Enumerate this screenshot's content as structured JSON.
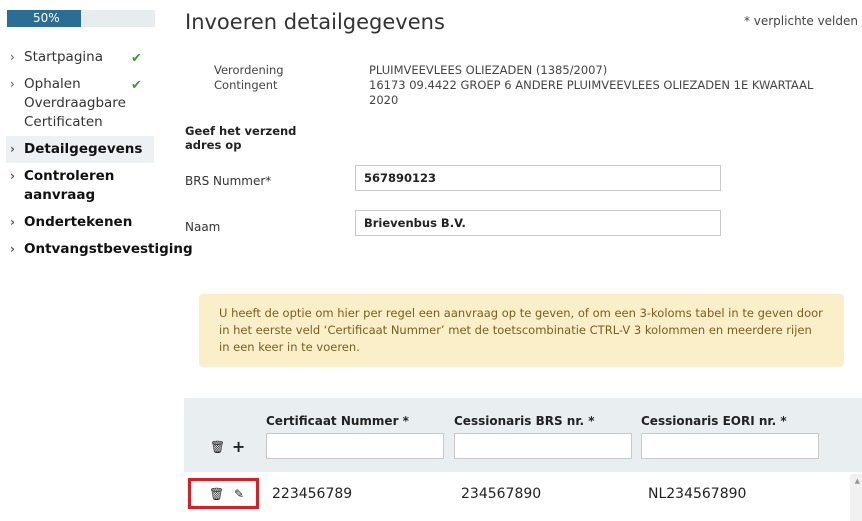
{
  "progress": {
    "label": "50%",
    "fraction": 0.5
  },
  "sidebar": {
    "items": [
      {
        "label": "Startpagina",
        "done": true
      },
      {
        "label": "Ophalen Overdraagbare Certificaten",
        "done": true
      },
      {
        "label": "Detailgegevens",
        "active": true
      },
      {
        "label": "Controleren aanvraag"
      },
      {
        "label": "Ondertekenen"
      },
      {
        "label": "Ontvangstbevestiging"
      }
    ],
    "chevron": "›",
    "check": "✔"
  },
  "header": {
    "title": "Invoeren detailgegevens",
    "required_note": "* verplichte velden"
  },
  "info": {
    "verordening_label": "Verordening",
    "verordening_value": "PLUIMVEEVLEES OLIEZADEN (1385/2007)",
    "contingent_label": "Contingent",
    "contingent_value": "16173 09.4422 GROEP 6 ANDERE PLUIMVEEVLEES OLIEZADEN 1E KWARTAAL 2020"
  },
  "address": {
    "section_label": "Geef het verzend adres op",
    "brs_label": "BRS Nummer*",
    "brs_value": "567890123",
    "naam_label": "Naam",
    "naam_value": "Brievenbus B.V."
  },
  "notice": {
    "text": "U heeft de optie om hier per regel een aanvraag op te geven, of om een 3-koloms tabel in te geven door in het eerste veld ‘Certificaat Nummer’ met de toetscombinatie CTRL-V 3 kolommen en meerdere rijen in een keer in te voeren."
  },
  "table": {
    "columns": [
      "Certificaat Nummer *",
      "Cessionaris BRS nr. *",
      "Cessionaris EORI nr. *"
    ],
    "rows": [
      [
        "223456789",
        "234567890",
        "NL234567890"
      ]
    ],
    "icons": {
      "delete": "trash-icon",
      "add": "plus-icon",
      "edit": "pencil-icon"
    }
  },
  "colors": {
    "progress": "#2a6d97",
    "check": "#3d9a2c",
    "notice_bg": "#fbefc9",
    "highlight": "#e01b24"
  }
}
